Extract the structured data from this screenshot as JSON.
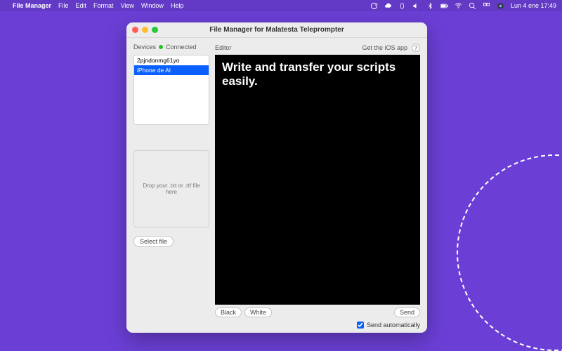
{
  "menubar": {
    "appName": "File Manager",
    "items": [
      "File",
      "Edit",
      "Format",
      "View",
      "Window",
      "Help"
    ],
    "clock": "Lun 4 ene  17:49"
  },
  "window": {
    "title": "File Manager for Malatesta Teleprompter"
  },
  "sidebar": {
    "devicesLabel": "Devices",
    "statusLabel": "Connected",
    "devices": [
      {
        "name": "2pjndonmg61yo",
        "selected": false
      },
      {
        "name": "iPhone de Al",
        "selected": true
      }
    ],
    "dropzoneText": "Drop your .txt or .rtf file here",
    "selectFileLabel": "Select file"
  },
  "main": {
    "editorLabel": "Editor",
    "getAppLabel": "Get the iOS app",
    "helpLabel": "?",
    "editorText": "Write and transfer your scripts easily.",
    "blackLabel": "Black",
    "whiteLabel": "White",
    "sendLabel": "Send",
    "sendAutoLabel": "Send automatically",
    "sendAutoChecked": true
  }
}
